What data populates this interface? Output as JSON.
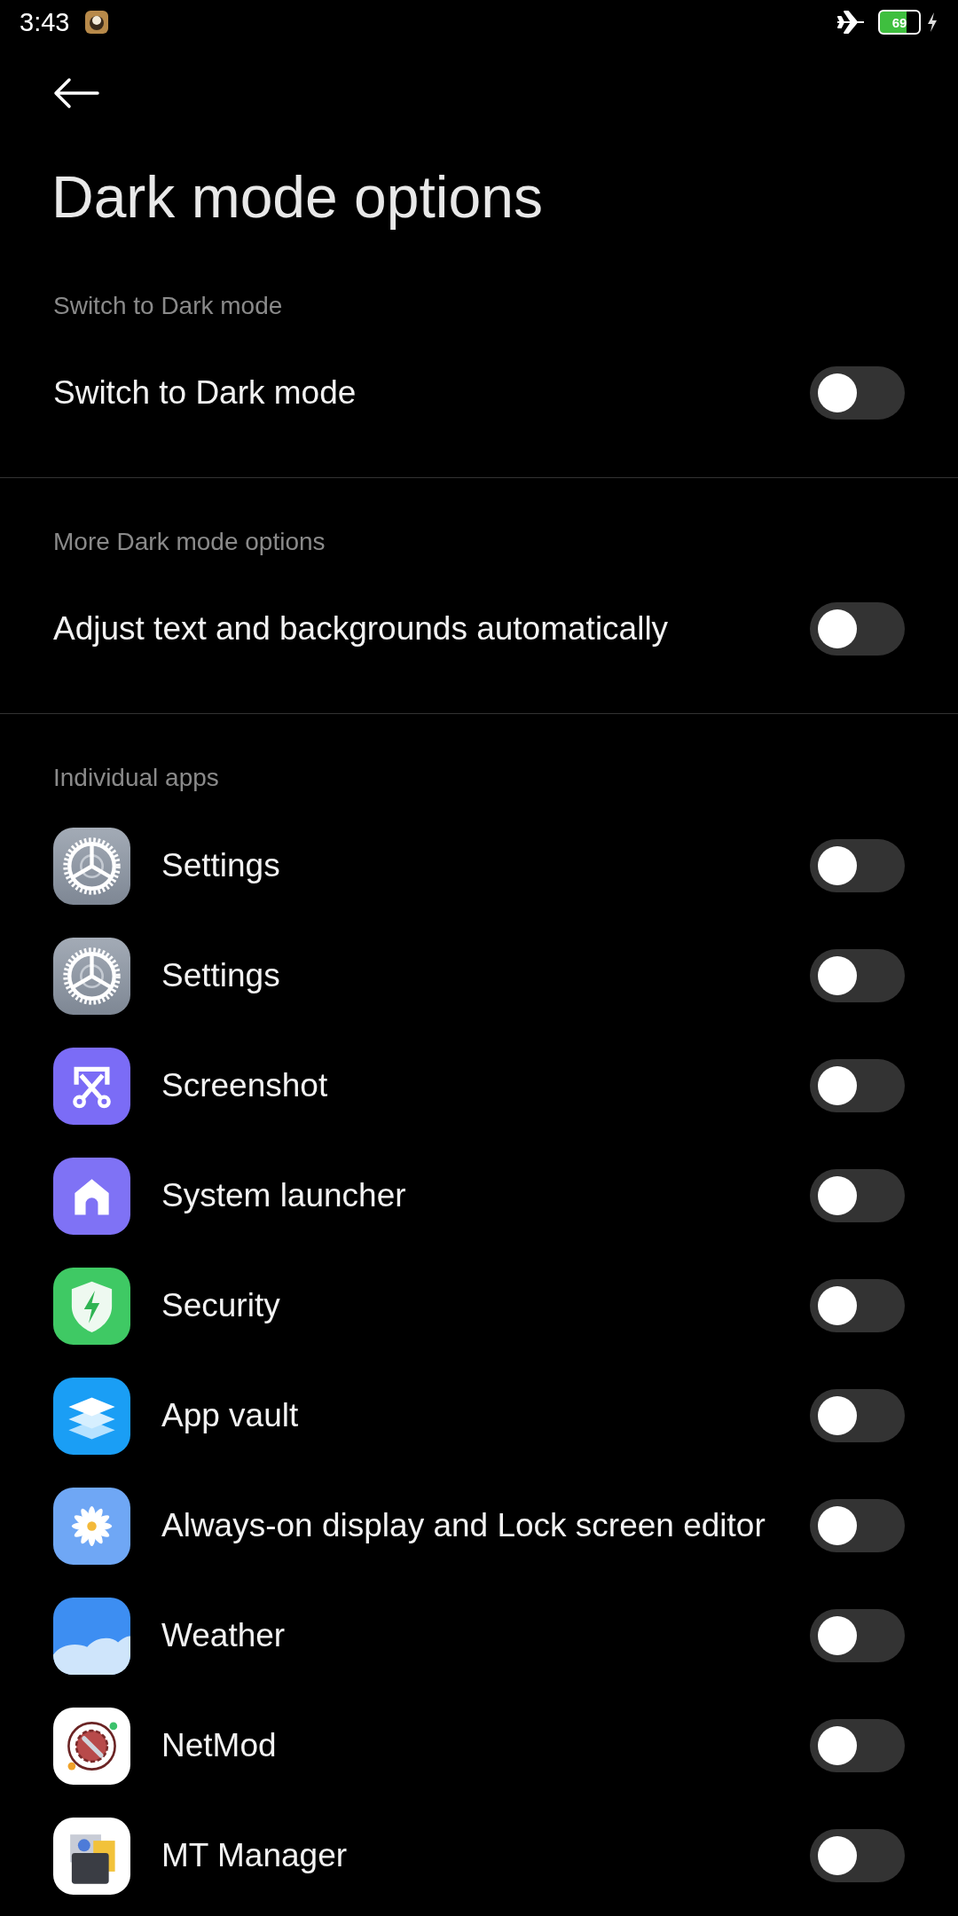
{
  "status_bar": {
    "time": "3:43",
    "battery": "69"
  },
  "title": "Dark mode options",
  "sections": [
    {
      "label": "Switch to Dark mode",
      "rows": [
        {
          "label": "Switch to Dark mode",
          "on": false
        }
      ]
    },
    {
      "label": "More Dark mode options",
      "rows": [
        {
          "label": "Adjust text and backgrounds automatically",
          "on": false
        }
      ]
    },
    {
      "label": "Individual apps",
      "rows": [
        {
          "label": "Settings",
          "on": false
        },
        {
          "label": "Settings",
          "on": false
        },
        {
          "label": "Screenshot",
          "on": false
        },
        {
          "label": "System launcher",
          "on": false
        },
        {
          "label": "Security",
          "on": false
        },
        {
          "label": "App vault",
          "on": false
        },
        {
          "label": "Always-on display and Lock screen editor",
          "on": false
        },
        {
          "label": "Weather",
          "on": false
        },
        {
          "label": "NetMod",
          "on": false
        },
        {
          "label": "MT Manager",
          "on": false
        }
      ]
    }
  ]
}
